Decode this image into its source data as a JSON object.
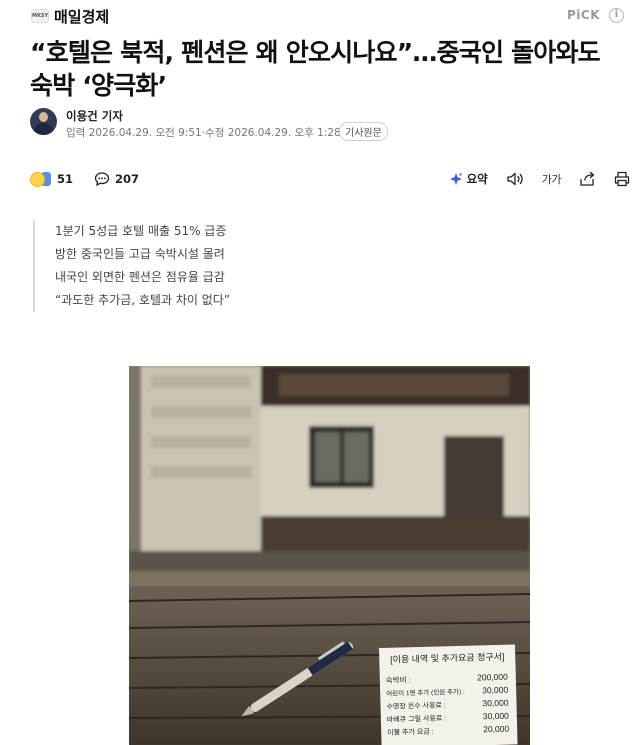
{
  "press": {
    "logo_text": "MKSY",
    "name": "매일경제",
    "pick_label": "PiCK",
    "pick_info_glyph": "i"
  },
  "article": {
    "headline_line1": "“호텔은 북적, 펜션은 왜 안오시나요”…중국인 돌아와도",
    "headline_line2": "숙박 ‘양극화’"
  },
  "byline": {
    "reporter": "이용건 기자",
    "input_label": "입력",
    "input_time": "2026.04.29. 오전 9:51",
    "separator": "·",
    "modified_label": "수정",
    "modified_time": "2026.04.29. 오후 1:28",
    "original_link": "기사원문"
  },
  "actions": {
    "reaction_count": "51",
    "comment_count": "207",
    "summary_label": "요약",
    "fontsize_label": "가가"
  },
  "summary": {
    "lines": [
      "1분기 5성급 호텔 매출 51% 급증",
      "방한 중국인들 고급 숙박시설 몰려",
      "내국인 외면한 펜션은 점유율 급감",
      "“과도한 추가금, 호텔과 차이 없다”"
    ]
  },
  "photo": {
    "receipt_title": "[이용 내역 및 추가요금 청구서]",
    "receipt_items": [
      {
        "label": "숙박비 :",
        "amount": "200,000"
      },
      {
        "label": "어린이 1명 추가 (인원 추가) :",
        "amount": "30,000"
      },
      {
        "label": "수영장 온수 사용료 :",
        "amount": "30,000"
      },
      {
        "label": "바베큐 그릴 사용료 :",
        "amount": "30,000"
      },
      {
        "label": "이불 추가 요금 :",
        "amount": "20,000"
      }
    ]
  },
  "colors": {
    "accent_summary": "#3b5bdb",
    "text_primary": "#111111",
    "text_muted": "#777777"
  }
}
